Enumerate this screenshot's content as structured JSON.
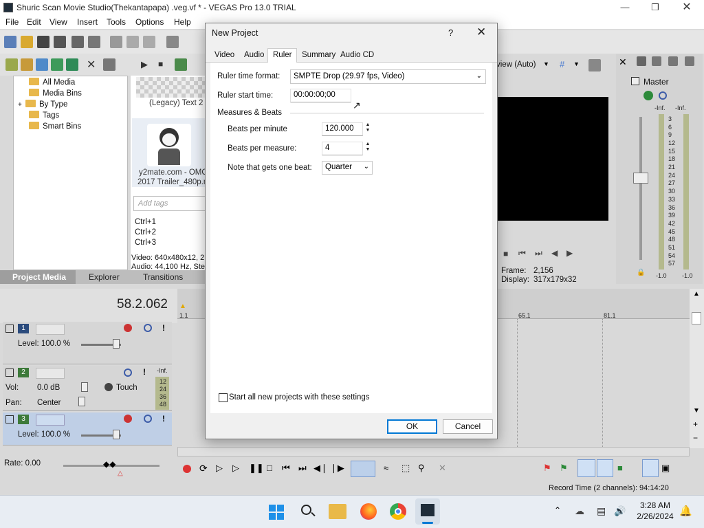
{
  "window": {
    "title": "Shuric Scan Movie Studio(Thekantapapa) .veg.vf * - VEGAS Pro 13.0 TRIAL",
    "minimize_icon": "minimize-icon",
    "restore_icon": "restore-icon",
    "close_icon": "close-icon"
  },
  "menu": [
    "File",
    "Edit",
    "View",
    "Insert",
    "Tools",
    "Options",
    "Help"
  ],
  "project_media": {
    "tree": [
      "All Media",
      "Media Bins",
      "By Type",
      "Tags",
      "Smart Bins"
    ],
    "tree_expander": "+",
    "thumb1_label": "(Legacy) Text 2",
    "thumb2_label_line1": "y2mate.com - OMOR",
    "thumb2_label_line2": "2017 Trailer_480p.m",
    "tags_placeholder": "Add tags",
    "shortcuts": [
      "Ctrl+1",
      "Ctrl+2",
      "Ctrl+3"
    ],
    "info_line1": "Video: 640x480x12, 2",
    "info_line2": "Audio: 44,100 Hz, Ster",
    "tabs": [
      "Project Media",
      "Explorer",
      "Transitions"
    ]
  },
  "preview": {
    "quality_label": "view (Auto)",
    "frame_label": "Frame:",
    "frame_value": "2,156",
    "display_label": "Display:",
    "display_value": "317x179x32"
  },
  "master": {
    "title": "Master",
    "inf_left": "-Inf.",
    "inf_right": "-Inf.",
    "ticks": [
      "3",
      "6",
      "9",
      "12",
      "15",
      "18",
      "21",
      "24",
      "27",
      "30",
      "33",
      "36",
      "39",
      "42",
      "45",
      "48",
      "51",
      "54",
      "57"
    ],
    "bottom_left": "-1.0",
    "bottom_right": "-1.0"
  },
  "timeline": {
    "time_display": "58.2.062",
    "ruler_marks": [
      "1.1",
      "65.1",
      "81.1"
    ],
    "tracks": [
      {
        "num": "1",
        "level_label": "Level: 100.0 %"
      },
      {
        "num": "2",
        "vol_label": "Vol:",
        "vol_value": "0.0 dB",
        "pan_label": "Pan:",
        "pan_value": "Center",
        "mode": "Touch",
        "inf": "-Inf.",
        "meter_ticks": [
          "12",
          "24",
          "36",
          "48"
        ]
      },
      {
        "num": "3",
        "level_label": "Level: 100.0 %"
      }
    ],
    "rate_label": "Rate: 0.00"
  },
  "status_bar": {
    "record_time": "Record Time (2 channels): 94:14:20"
  },
  "dialog": {
    "title": "New Project",
    "help": "?",
    "close": "✕",
    "tabs": [
      "Video",
      "Audio",
      "Ruler",
      "Summary",
      "Audio CD"
    ],
    "active_tab": "Ruler",
    "ruler_time_format_label": "Ruler time format:",
    "ruler_time_format_value": "SMPTE Drop (29.97 fps, Video)",
    "ruler_start_time_label": "Ruler start time:",
    "ruler_start_time_value": "00:00:00;00",
    "measures_group": "Measures & Beats",
    "bpm_label": "Beats per minute",
    "bpm_value": "120.000",
    "bpmeasure_label": "Beats per measure:",
    "bpmeasure_value": "4",
    "note_label": "Note that gets one beat:",
    "note_value": "Quarter",
    "start_all_label": "Start all new projects with these settings",
    "start_all_checked": false,
    "ok": "OK",
    "cancel": "Cancel"
  },
  "taskbar": {
    "time": "3:28 AM",
    "date": "2/26/2024"
  }
}
